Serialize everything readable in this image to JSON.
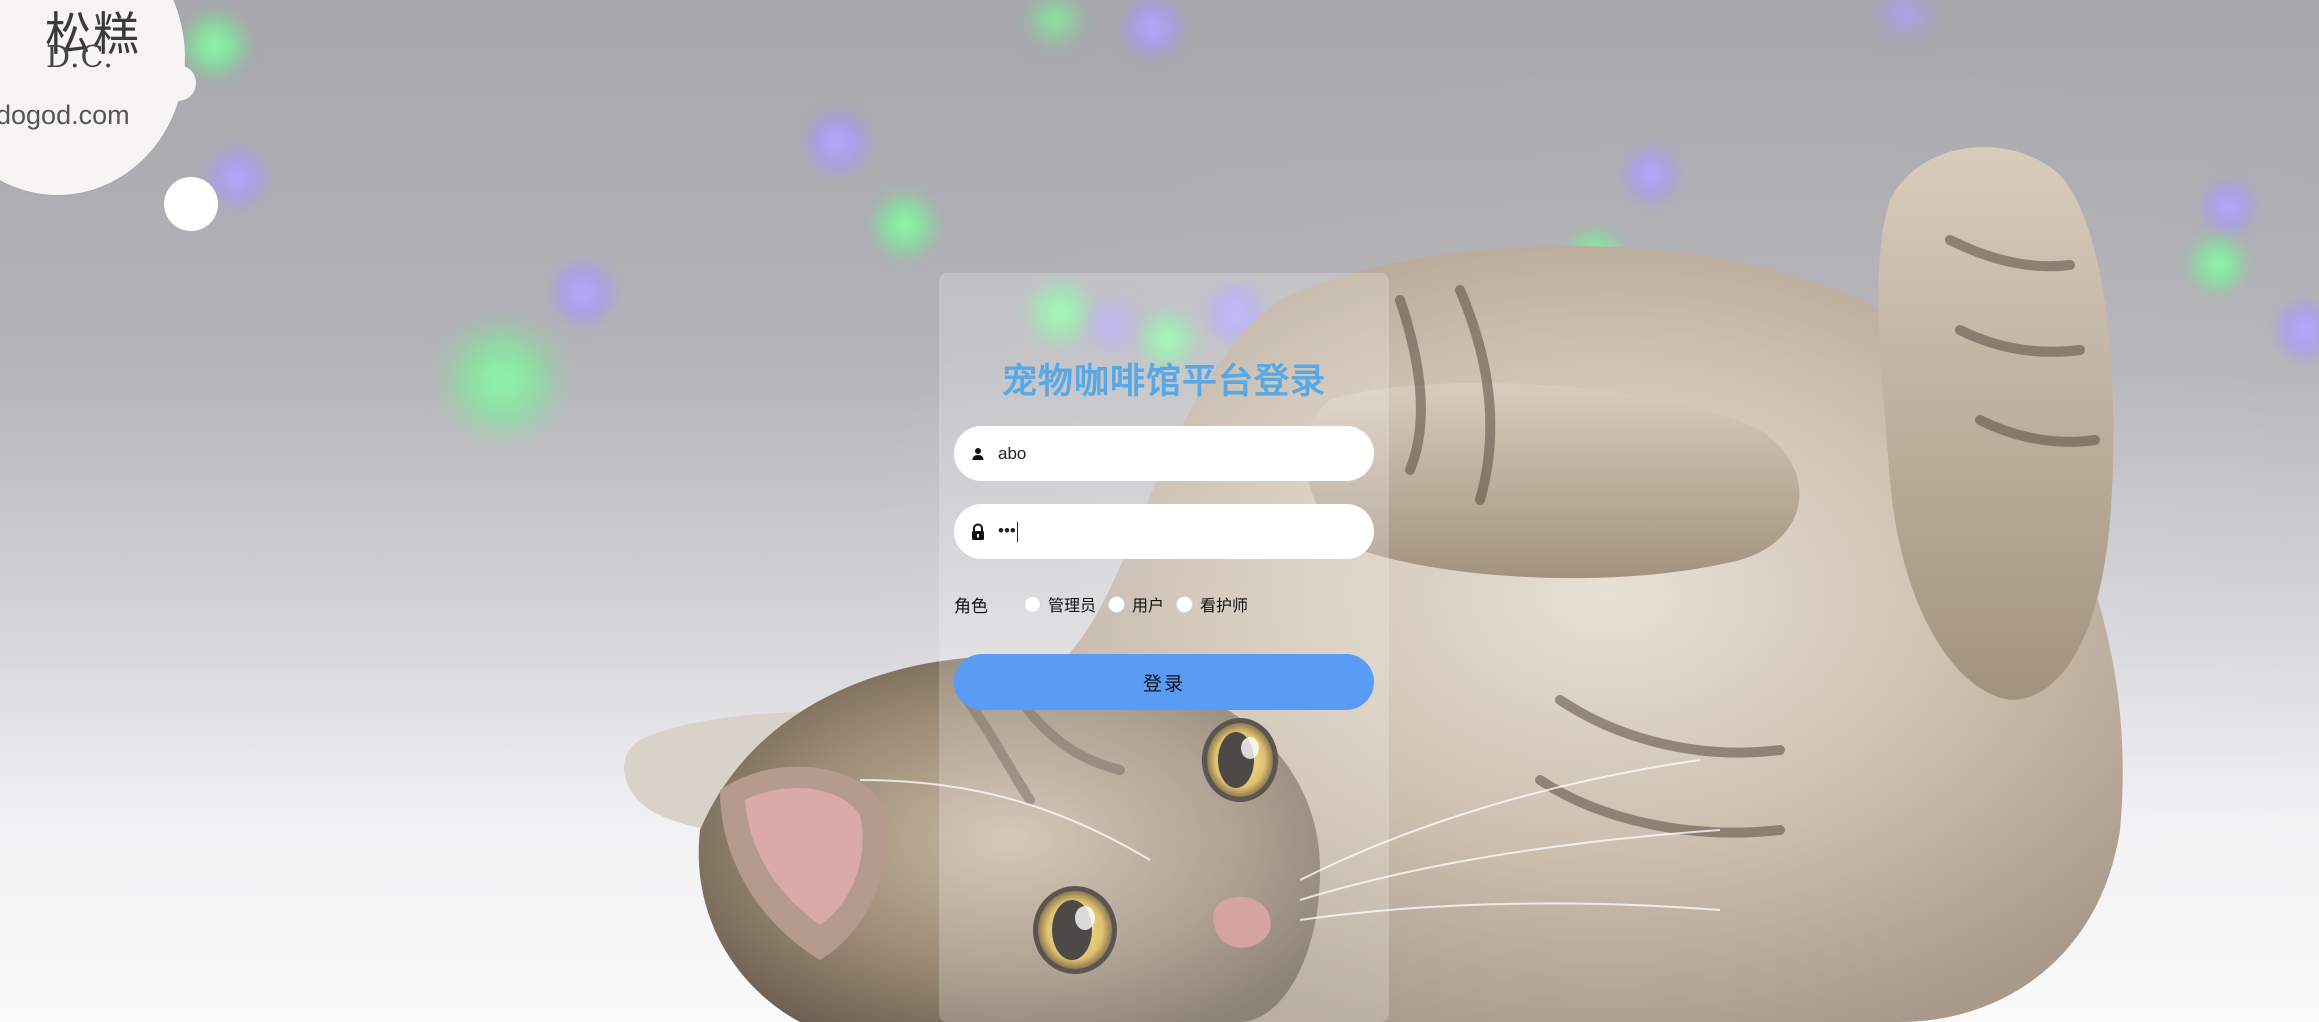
{
  "logo": {
    "brand_text": "松糕",
    "initials": "D.C.",
    "website": "dogod.com"
  },
  "login": {
    "title": "宠物咖啡馆平台登录",
    "username": {
      "value": "abo",
      "icon": "user-icon"
    },
    "password": {
      "value": "•••",
      "icon": "lock-icon"
    },
    "role": {
      "label": "角色",
      "options": [
        "管理员",
        "用户",
        "看护师"
      ],
      "selected": null
    },
    "submit_label": "登录"
  },
  "colors": {
    "title": "#58a8e6",
    "button": "#5a9bf6",
    "panel": "rgba(255,255,255,0.22)"
  }
}
